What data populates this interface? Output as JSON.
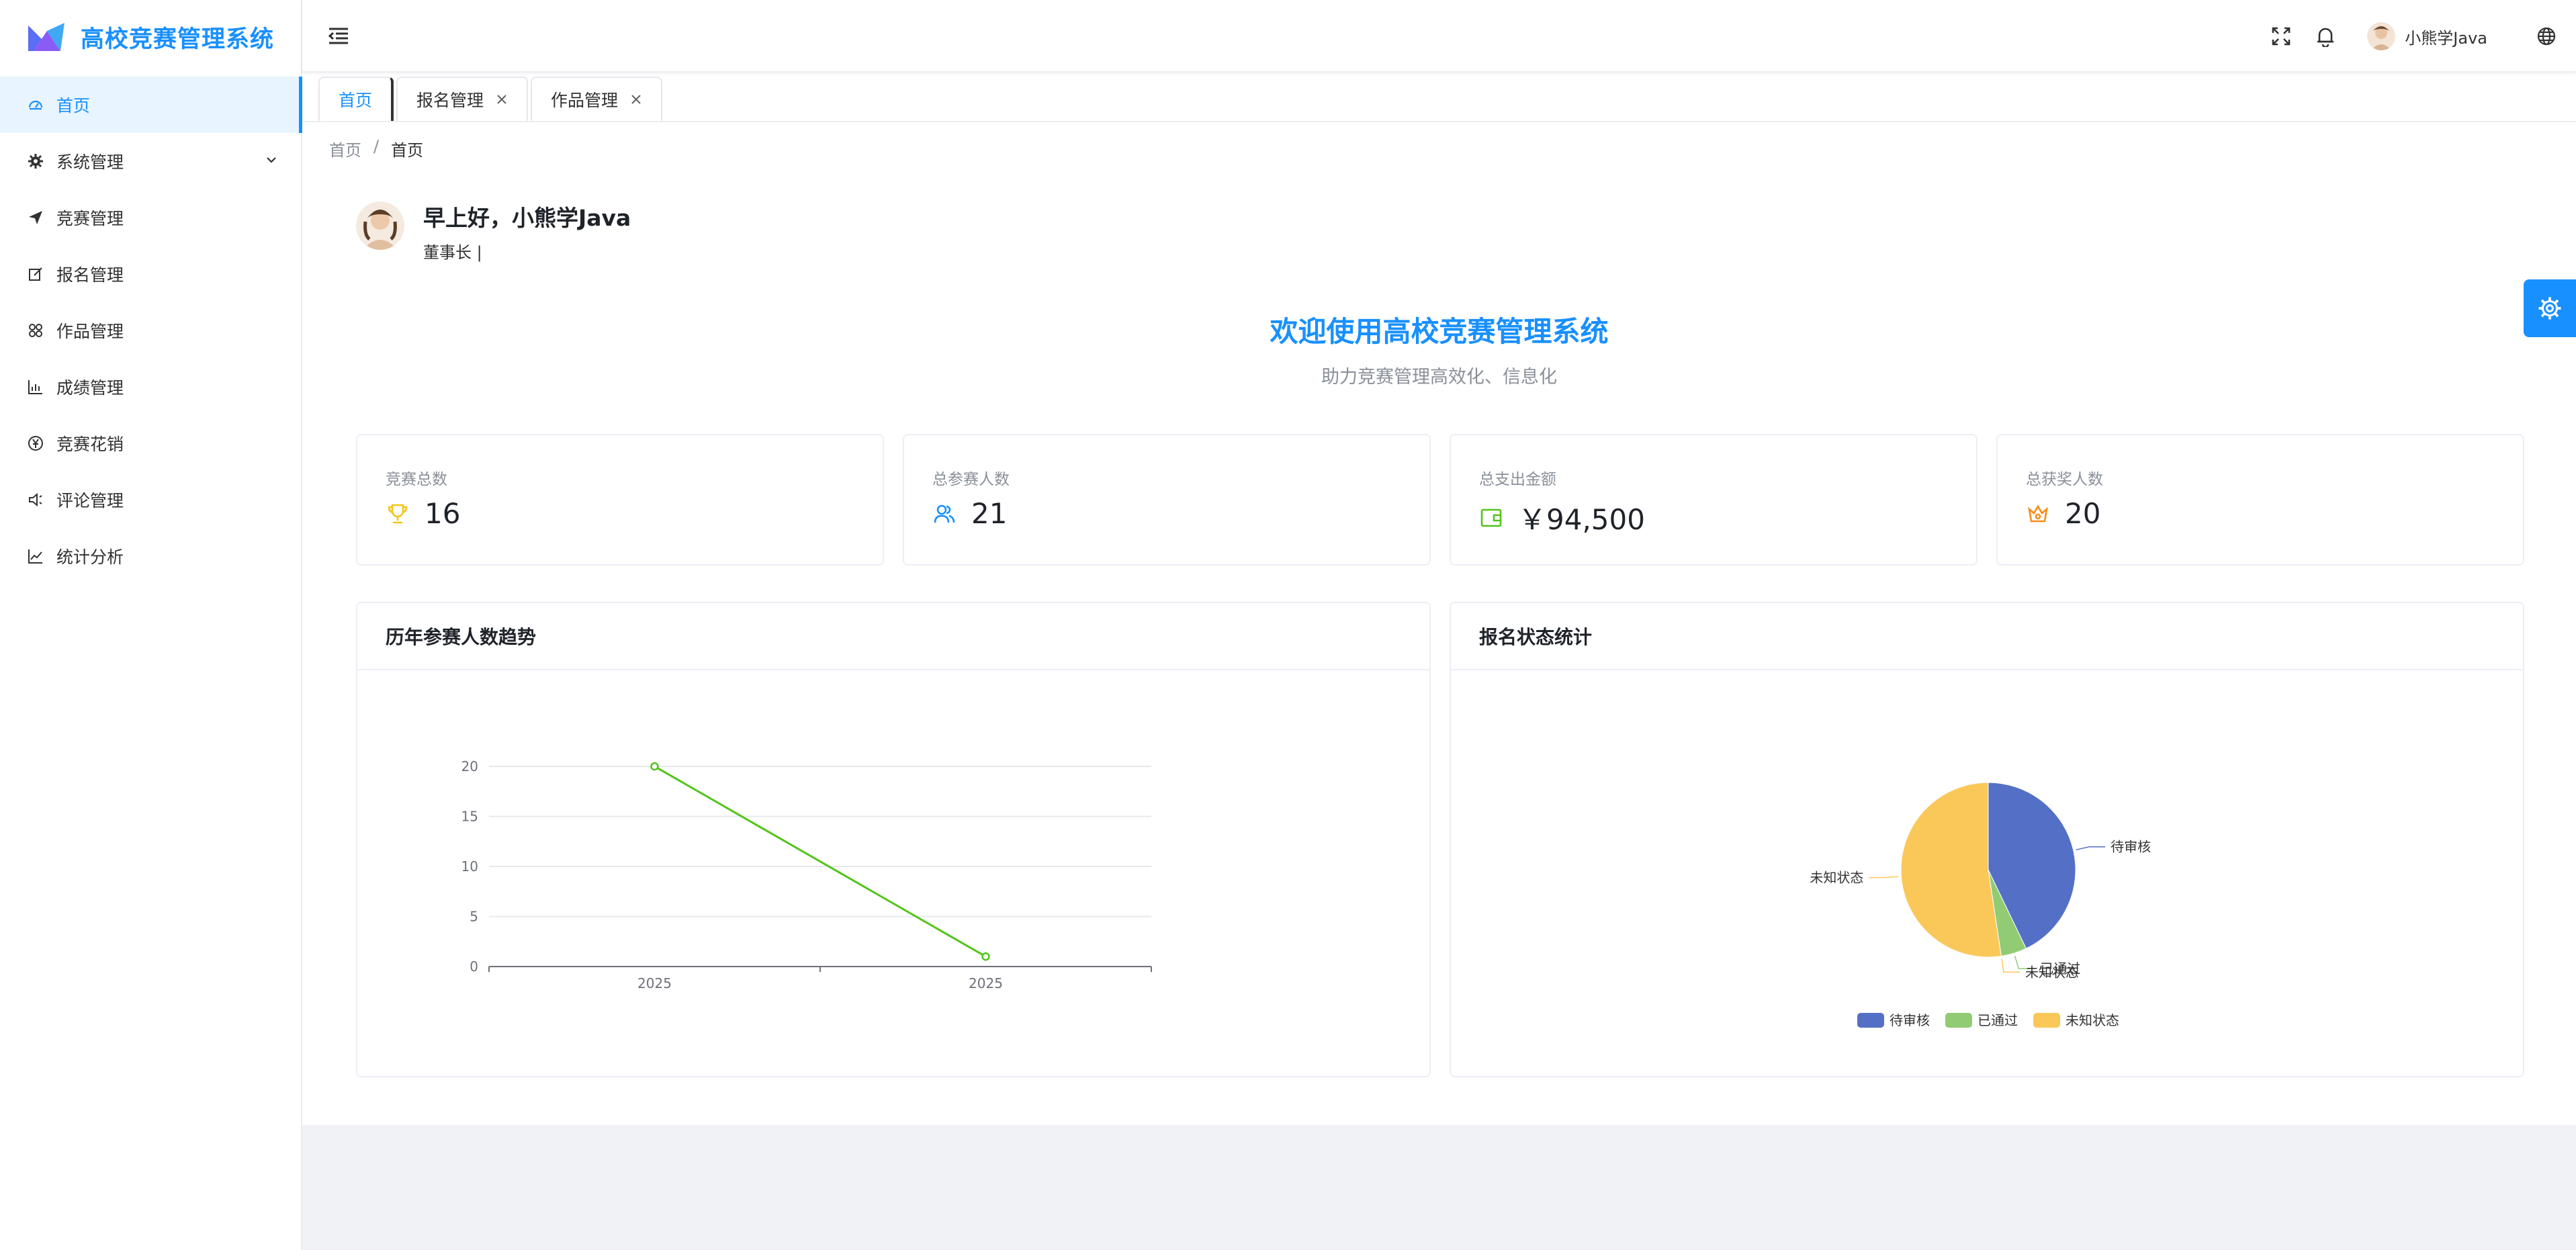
{
  "app": {
    "title": "高校竞赛管理系统"
  },
  "sidebar": {
    "items": [
      {
        "label": "首页",
        "icon": "dashboard-icon",
        "active": true
      },
      {
        "label": "系统管理",
        "icon": "gear-icon",
        "expandable": true
      },
      {
        "label": "竞赛管理",
        "icon": "send-icon"
      },
      {
        "label": "报名管理",
        "icon": "edit-icon"
      },
      {
        "label": "作品管理",
        "icon": "grid-icon"
      },
      {
        "label": "成绩管理",
        "icon": "bar-chart-icon"
      },
      {
        "label": "竞赛花销",
        "icon": "yen-icon"
      },
      {
        "label": "评论管理",
        "icon": "speaker-icon"
      },
      {
        "label": "统计分析",
        "icon": "line-chart-icon"
      }
    ]
  },
  "header": {
    "username": "小熊学Java",
    "icons": [
      "fullscreen-icon",
      "bell-icon",
      "globe-icon"
    ]
  },
  "tags": [
    {
      "label": "首页",
      "active": true,
      "closable": false
    },
    {
      "label": "报名管理",
      "active": false,
      "closable": true
    },
    {
      "label": "作品管理",
      "active": false,
      "closable": true
    }
  ],
  "breadcrumb": [
    "首页",
    "首页"
  ],
  "greeting": {
    "title": "早上好，小熊学Java",
    "role": "董事长 |"
  },
  "welcome": {
    "title": "欢迎使用高校竞赛管理系统",
    "subtitle": "助力竞赛管理高效化、信息化"
  },
  "stats": [
    {
      "label": "竞赛总数",
      "value": "16",
      "icon": "trophy-icon",
      "color": "#f5c518"
    },
    {
      "label": "总参赛人数",
      "value": "21",
      "icon": "users-icon",
      "color": "#1890ff"
    },
    {
      "label": "总支出金额",
      "value": "￥94,500",
      "icon": "wallet-icon",
      "color": "#52c41a"
    },
    {
      "label": "总获奖人数",
      "value": "20",
      "icon": "crown-icon",
      "color": "#fa8c16"
    }
  ],
  "panels": {
    "trend_title": "历年参赛人数趋势",
    "status_title": "报名状态统计"
  },
  "colors": {
    "accent": "#1890ff",
    "line": "#52c41a",
    "pie_pending": "#5470c6",
    "pie_passed": "#91cc75",
    "pie_unknown": "#fac858"
  },
  "chart_data": [
    {
      "type": "line",
      "title": "历年参赛人数趋势",
      "x": [
        "2025",
        "2025"
      ],
      "series": [
        {
          "values": [
            20,
            1
          ]
        }
      ],
      "ylim": [
        0,
        20
      ],
      "yticks": [
        0,
        5,
        10,
        15,
        20
      ],
      "grid": true
    },
    {
      "type": "pie",
      "title": "报名状态统计",
      "slices": [
        {
          "label": "待审核",
          "value": 9
        },
        {
          "label": "已通过",
          "value": 1
        },
        {
          "label": "未知状态",
          "value": 0.0001
        },
        {
          "label": "未知状态",
          "value": 11
        }
      ],
      "legend": [
        "待审核",
        "已通过",
        "未知状态"
      ],
      "legend_position": "bottom"
    }
  ]
}
